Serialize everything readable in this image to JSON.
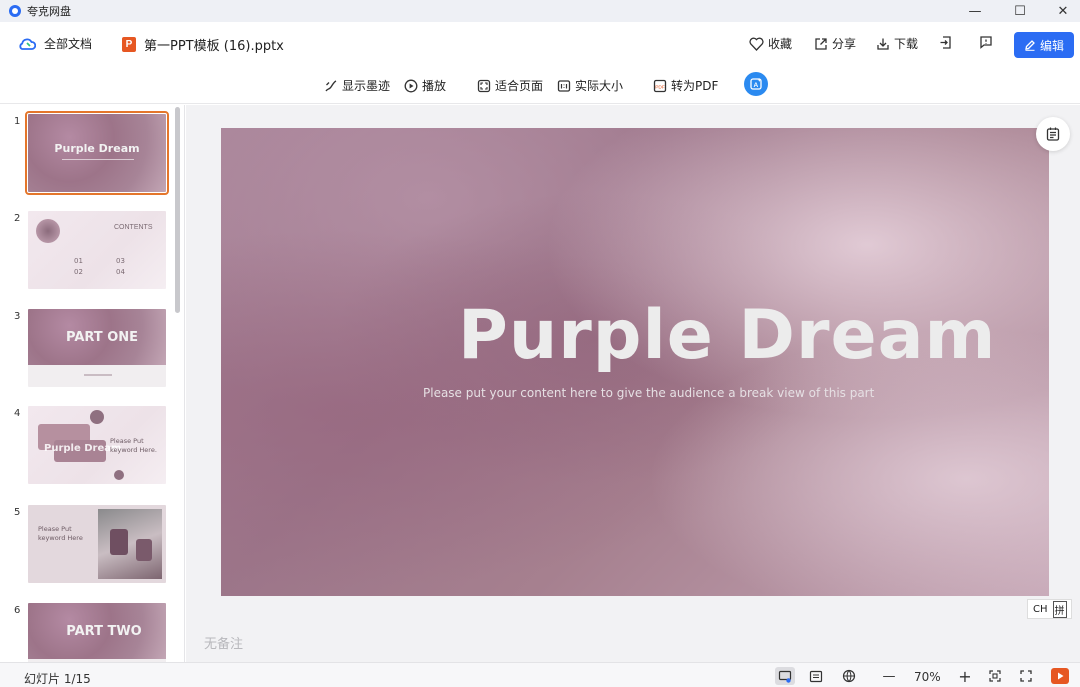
{
  "window": {
    "title": "夸克网盘",
    "minimize": "—",
    "maximize": "☐",
    "close": "✕"
  },
  "docbar": {
    "all_docs": "全部文档",
    "file_icon": "P",
    "file_name": "第一PPT模板 (16).pptx",
    "favorite": "收藏",
    "share": "分享",
    "download": "下载",
    "edit": "编辑"
  },
  "viewbar": {
    "show_ink": "显示墨迹",
    "play": "播放",
    "fit_page": "适合页面",
    "actual_size": "实际大小",
    "to_pdf": "转为PDF"
  },
  "thumbnails": [
    {
      "num": "1",
      "title": "Purple Dream"
    },
    {
      "num": "2",
      "title": "CONTENTS",
      "items": [
        "01",
        "02",
        "03",
        "04"
      ]
    },
    {
      "num": "3",
      "title": "PART ONE"
    },
    {
      "num": "4",
      "title": "Purple Dream",
      "side": "Please Put keyword Here."
    },
    {
      "num": "5",
      "side": "Please Put keyword Here"
    },
    {
      "num": "6",
      "title": "PART TWO"
    }
  ],
  "slide": {
    "title": "Purple Dream",
    "subtitle": "Please put your content here to give the audience a break view of this part"
  },
  "notes_placeholder": "无备注",
  "ime": {
    "mode": "CH",
    "input": "拼"
  },
  "status": {
    "slide_counter": "幻灯片 1/15",
    "zoom": "70%",
    "zoom_minus": "—",
    "zoom_plus": "+"
  },
  "colors": {
    "accent": "#2b6cf3",
    "ppt": "#e65722",
    "selection": "#e4762b"
  }
}
